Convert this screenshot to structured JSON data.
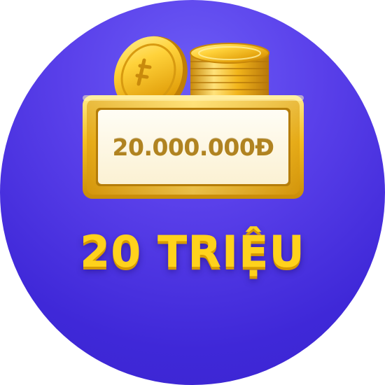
{
  "badge": {
    "amount_text": "20.000.000Đ",
    "title_text": "20 TRIỆU",
    "icon": "gold-coins-icon",
    "colors": {
      "background": "#4b33e0",
      "gold": "#ffd21c",
      "gold_dark": "#d79a00",
      "plate": "#fffbee",
      "amount_text": "#b08320"
    }
  }
}
